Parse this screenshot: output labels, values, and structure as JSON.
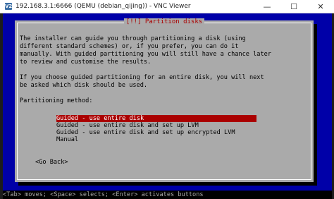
{
  "window": {
    "title": "192.168.3.1:6666 (QEMU (debian_qijing)) - VNC Viewer",
    "app_icon": "V2",
    "minimize_icon": "—",
    "maximize_icon": "☐",
    "close_icon": "✕"
  },
  "dialog": {
    "title": "[!!] Partition disks",
    "paragraph1": [
      "The installer can guide you through partitioning a disk (using",
      "different standard schemes) or, if you prefer, you can do it",
      "manually. With guided partitioning you will still have a chance later",
      "to review and customise the results."
    ],
    "paragraph2": [
      "If you choose guided partitioning for an entire disk, you will next",
      "be asked which disk should be used."
    ],
    "method_label": "Partitioning method:",
    "options": [
      "Guided - use entire disk",
      "Guided - use entire disk and set up LVM",
      "Guided - use entire disk and set up encrypted LVM",
      "Manual"
    ],
    "selected_index": 0,
    "go_back": "<Go Back>"
  },
  "status_bar": "<Tab> moves; <Space> selects; <Enter> activates buttons",
  "colors": {
    "screen_bg": "#0000a8",
    "dialog_bg": "#aaaaaa",
    "title_red": "#aa0000",
    "selection_bg": "#aa0000"
  }
}
